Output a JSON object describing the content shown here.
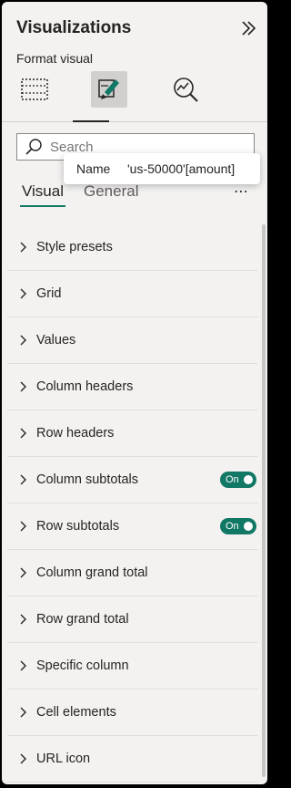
{
  "pane": {
    "title": "Visualizations",
    "subtitle": "Format visual",
    "collapse_icon": "double-chevron-right-icon",
    "viz_icons": [
      {
        "name": "build-visual-icon",
        "selected": false
      },
      {
        "name": "format-visual-icon",
        "selected": true
      },
      {
        "name": "analytics-icon",
        "selected": false
      }
    ]
  },
  "search": {
    "placeholder": "Search"
  },
  "tooltip": {
    "key": "Name",
    "value": "'us-50000'[amount]"
  },
  "tabs": {
    "visual": "Visual",
    "general": "General",
    "more": "⋯"
  },
  "sections": [
    {
      "label": "Style presets"
    },
    {
      "label": "Grid"
    },
    {
      "label": "Values"
    },
    {
      "label": "Column headers"
    },
    {
      "label": "Row headers"
    },
    {
      "label": "Column subtotals",
      "toggle": "On"
    },
    {
      "label": "Row subtotals",
      "toggle": "On"
    },
    {
      "label": "Column grand total"
    },
    {
      "label": "Row grand total"
    },
    {
      "label": "Specific column"
    },
    {
      "label": "Cell elements"
    },
    {
      "label": "URL icon"
    }
  ],
  "colors": {
    "accent": "#117865",
    "panel_bg": "#f3f2f1"
  }
}
